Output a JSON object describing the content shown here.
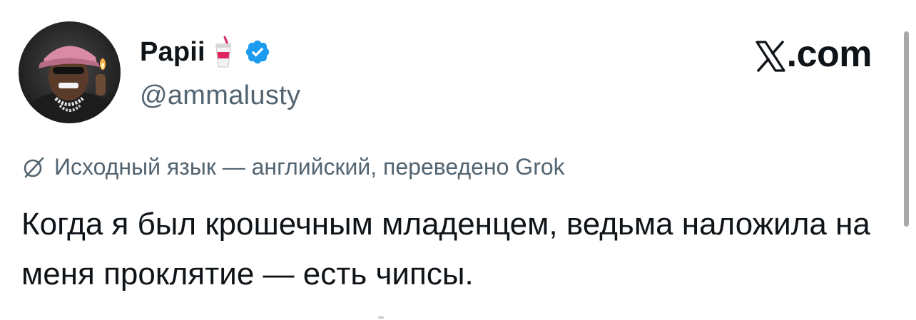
{
  "tweet": {
    "display_name": "Papii",
    "name_emoji": "soda-cup-emoji",
    "verified_badge": "verified-check-icon",
    "handle": "@ammalusty",
    "translation_note": "Исходный язык — английский, переведено Grok",
    "text": "Когда я был крошечным младенцем, ведьма наложила на меня проклятие — есть чипсы."
  },
  "brand": {
    "label": ".com",
    "mark": "x-logo-icon"
  },
  "colors": {
    "text_primary": "#0f1419",
    "text_secondary": "#536471",
    "verified_blue": "#1d9bf0",
    "background": "#ffffff"
  }
}
